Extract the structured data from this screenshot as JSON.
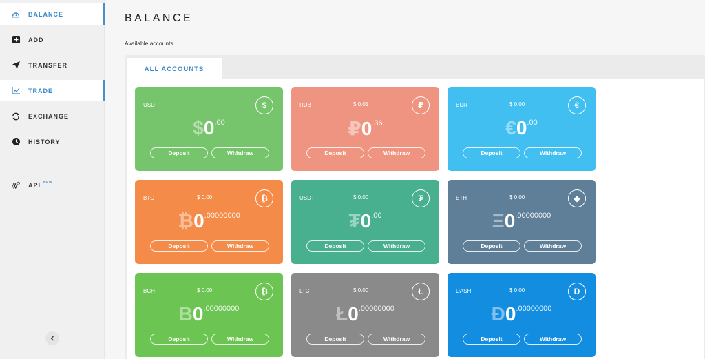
{
  "sidebar": {
    "items": [
      {
        "label": "BALANCE",
        "icon": "dashboard-icon",
        "active": true
      },
      {
        "label": "ADD",
        "icon": "plus-square-icon",
        "active": false
      },
      {
        "label": "TRANSFER",
        "icon": "paper-plane-icon",
        "active": false
      },
      {
        "label": "TRADE",
        "icon": "chart-icon",
        "active": true
      },
      {
        "label": "EXCHANGE",
        "icon": "exchange-icon",
        "active": false
      },
      {
        "label": "HISTORY",
        "icon": "clock-icon",
        "active": false
      },
      {
        "label": "API",
        "icon": "gears-icon",
        "badge": "NEW",
        "active": false
      }
    ],
    "collapse_icon": "chevron-left-icon"
  },
  "header": {
    "title": "BALANCE",
    "subtitle": "Available accounts"
  },
  "tabs": [
    {
      "label": "ALL ACCOUNTS",
      "active": true
    }
  ],
  "buttons": {
    "deposit": "Deposit",
    "withdraw": "Withdraw"
  },
  "accounts": [
    {
      "code": "USD",
      "usd_value": "",
      "symbol": "$",
      "integer": "0",
      "decimals": ".00",
      "color": "#76c46b",
      "icon_glyph": "$"
    },
    {
      "code": "RUB",
      "usd_value": "$ 0.01",
      "symbol": "₽",
      "integer": "0",
      "decimals": ".36",
      "color": "#ef9480",
      "icon_glyph": "₽"
    },
    {
      "code": "EUR",
      "usd_value": "$ 0.00",
      "symbol": "€",
      "integer": "0",
      "decimals": ".00",
      "color": "#41bff0",
      "icon_glyph": "€"
    },
    {
      "code": "BTC",
      "usd_value": "$ 0.00",
      "symbol": "₿",
      "integer": "0",
      "decimals": ".00000000",
      "color": "#f58b48",
      "icon_glyph": "₿"
    },
    {
      "code": "USDT",
      "usd_value": "$ 0.00",
      "symbol": "₮",
      "integer": "0",
      "decimals": ".00",
      "color": "#48b08e",
      "icon_glyph": "₮"
    },
    {
      "code": "ETH",
      "usd_value": "$ 0.00",
      "symbol": "Ξ",
      "integer": "0",
      "decimals": ".00000000",
      "color": "#5f7e98",
      "icon_glyph": "◆"
    },
    {
      "code": "BCH",
      "usd_value": "$ 0.00",
      "symbol": "B",
      "integer": "0",
      "decimals": ".00000000",
      "color": "#6cc552",
      "icon_glyph": "₿"
    },
    {
      "code": "LTC",
      "usd_value": "$ 0.00",
      "symbol": "Ł",
      "integer": "0",
      "decimals": ".00000000",
      "color": "#8a8a8a",
      "icon_glyph": "Ł"
    },
    {
      "code": "DASH",
      "usd_value": "$ 0.00",
      "symbol": "Đ",
      "integer": "0",
      "decimals": ".00000000",
      "color": "#128de0",
      "icon_glyph": "D"
    }
  ]
}
